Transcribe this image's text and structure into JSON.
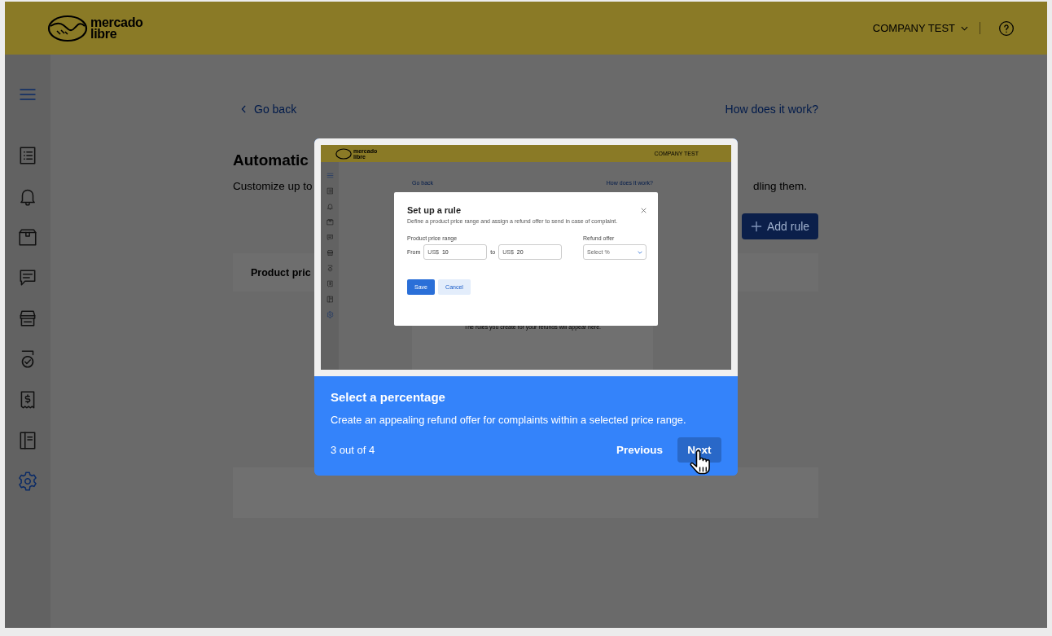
{
  "header": {
    "brand_lines": [
      "mercado",
      "libre"
    ],
    "account": "COMPANY TEST"
  },
  "sidebar": {
    "items": [
      {
        "kind": "list",
        "selected": false
      },
      {
        "kind": "bell",
        "selected": false
      },
      {
        "kind": "box",
        "selected": false
      },
      {
        "kind": "chat",
        "selected": false
      },
      {
        "kind": "store",
        "selected": false
      },
      {
        "kind": "badge",
        "selected": false
      },
      {
        "kind": "receipt",
        "selected": false
      },
      {
        "kind": "book",
        "selected": false
      },
      {
        "kind": "settings",
        "selected": true
      }
    ]
  },
  "page": {
    "back_link": "Go back",
    "help_link": "How does it work?",
    "title": "Automatic",
    "description_left": "Customize up to",
    "description_right": "dling them.",
    "add_button": "Add rule",
    "table_header": "Product pric"
  },
  "tour": {
    "screenshot": {
      "brand_lines": [
        "mercado",
        "libre"
      ],
      "account": "COMPANY TEST",
      "back_link": "Go back",
      "help_link": "How does it work?",
      "empty_text": "The rules you create for your refunds will appear here.",
      "modal": {
        "title": "Set up a rule",
        "description": "Define a product price range and assign a refund offer to send in case of complaint.",
        "range_label": "Product price range",
        "from_label": "From",
        "from_prefix": "US$",
        "from_value": "10",
        "to_label": "to",
        "to_prefix": "US$",
        "to_value": "20",
        "offer_label": "Refund offer",
        "offer_placeholder": "Select %",
        "save": "Save",
        "cancel": "Cancel"
      }
    },
    "title": "Select a percentage",
    "text": "Create an appealing refund offer for complaints within a selected price range.",
    "step": "3 out of 4",
    "previous": "Previous",
    "next": "Next"
  }
}
